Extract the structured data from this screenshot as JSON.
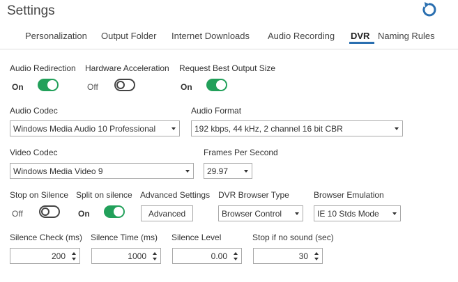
{
  "title": "Settings",
  "icons": {
    "refresh": "refresh-icon"
  },
  "colors": {
    "accent": "#2a6fb0",
    "toggle_on": "#22a05a"
  },
  "tabs": [
    {
      "label": "Personalization"
    },
    {
      "label": "Output Folder"
    },
    {
      "label": "Internet Downloads"
    },
    {
      "label": "Audio Recording"
    },
    {
      "label": "DVR",
      "active": true
    },
    {
      "label": "Naming Rules"
    }
  ],
  "toggles": {
    "audio_redirection": {
      "label": "Audio Redirection",
      "state": "On"
    },
    "hardware_acceleration": {
      "label": "Hardware Acceleration",
      "state": "Off"
    },
    "request_best_output": {
      "label": "Request Best Output Size",
      "state": "On"
    },
    "stop_on_silence": {
      "label": "Stop on Silence",
      "state": "Off"
    },
    "split_on_silence": {
      "label": "Split on silence",
      "state": "On"
    }
  },
  "selects": {
    "audio_codec": {
      "label": "Audio Codec",
      "value": "Windows Media Audio 10 Professional"
    },
    "audio_format": {
      "label": "Audio Format",
      "value": "192 kbps, 44 kHz, 2 channel 16 bit CBR"
    },
    "video_codec": {
      "label": "Video Codec",
      "value": "Windows Media Video 9"
    },
    "fps": {
      "label": "Frames Per Second",
      "value": "29.97"
    },
    "dvr_browser_type": {
      "label": "DVR Browser Type",
      "value": "Browser Control"
    },
    "browser_emulation": {
      "label": "Browser Emulation",
      "value": "IE 10 Stds Mode"
    }
  },
  "advanced": {
    "label": "Advanced Settings",
    "button": "Advanced"
  },
  "spinners": {
    "silence_check": {
      "label": "Silence Check (ms)",
      "value": "200"
    },
    "silence_time": {
      "label": "Silence Time (ms)",
      "value": "1000"
    },
    "silence_level": {
      "label": "Silence Level",
      "value": "0.00"
    },
    "stop_no_sound": {
      "label": "Stop if no sound (sec)",
      "value": "30"
    }
  }
}
